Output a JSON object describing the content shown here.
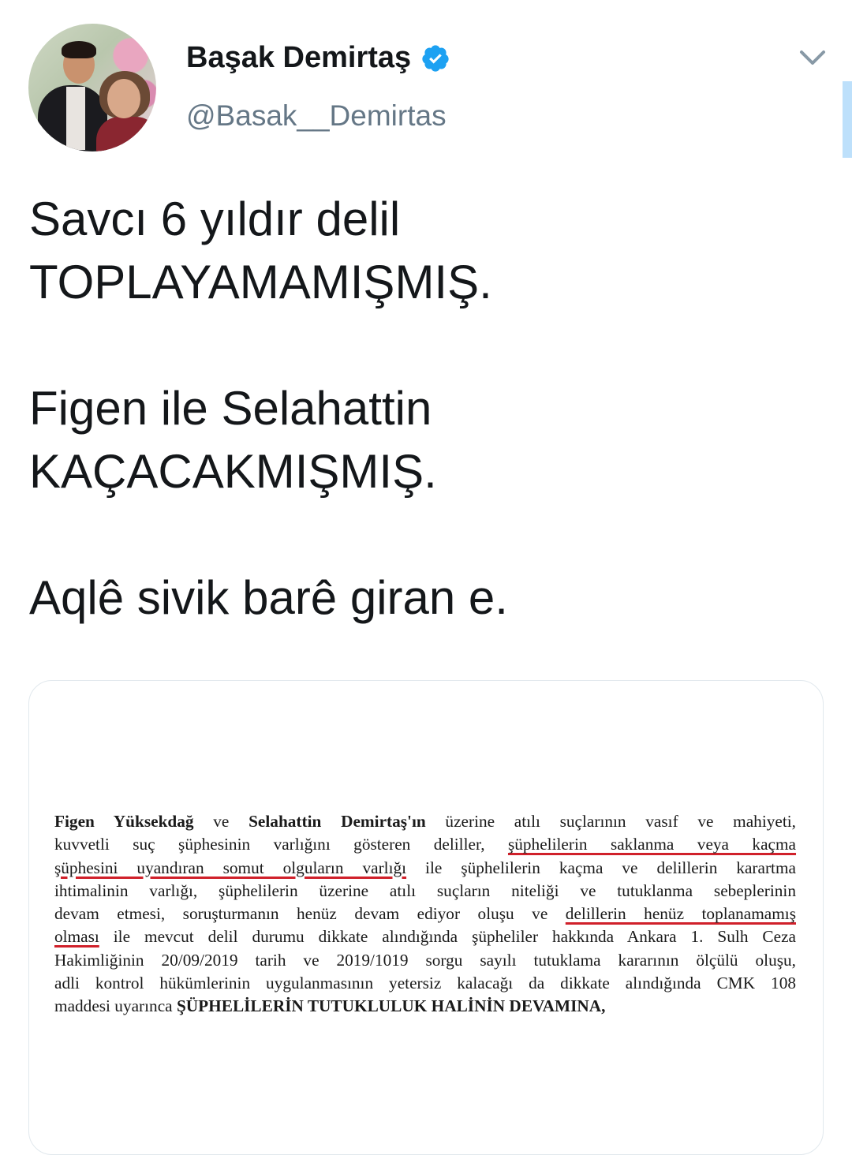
{
  "author": {
    "name": "Başak Demirtaş",
    "handle": "@Basak__Demirtas",
    "verified_color": "#1da1f2"
  },
  "tweet": {
    "text": "Savcı 6 yıldır delil\nTOPLAYAMAMIŞMIŞ.\n\nFigen ile Selahattin\nKAÇACAKMIŞMIŞ.\n\nAqlê sivik barê giran e."
  },
  "document": {
    "l1_bold_a": "Figen Yüksekdağ",
    "l1_mid": " ve ",
    "l1_bold_b": "Selahattin Demirtaş'ın",
    "l1_rest": " üzerine atılı suçlarının vasıf ve mahiyeti,",
    "l2_pre": "kuvvetli suç şüphesinin varlığını gösteren deliller, ",
    "l2_ul": "şüphelilerin saklanma veya kaçma",
    "l3_ul": "şüphesini uyandıran somut olguların varlığı",
    "l3_rest": " ile şüphelilerin kaçma ve delillerin karartma",
    "l4": "ihtimalinin varlığı, şüphelilerin üzerine atılı suçların niteliği ve tutuklanma sebeplerinin",
    "l5_pre": "devam etmesi,  soruşturmanın henüz devam ediyor oluşu ve ",
    "l5_ul": "delillerin henüz toplanamamış",
    "l6_ul": "olması",
    "l6_rest": " ile mevcut delil durumu dikkate alındığında şüpheliler hakkında Ankara 1. Sulh Ceza",
    "l7": "Hakimliğinin 20/09/2019 tarih ve 2019/1019 sorgu sayılı tutuklama kararının ölçülü oluşu,",
    "l8": "adli kontrol hükümlerinin uygulanmasının yetersiz kalacağı da dikkate alındığında  CMK 108",
    "l9_pre": "maddesi uyarınca ",
    "l9_bold": "ŞÜPHELİLERİN TUTUKLULUK HALİNİN DEVAMINA,"
  }
}
